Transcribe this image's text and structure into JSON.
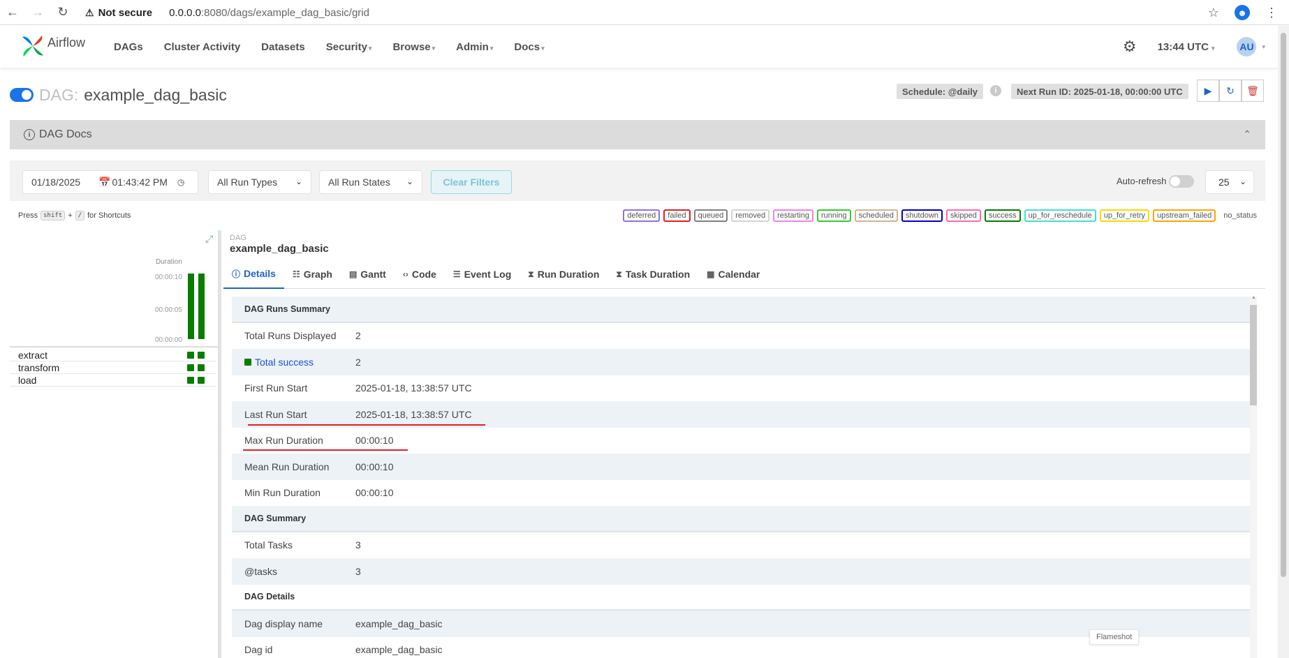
{
  "browser": {
    "security_label": "Not secure",
    "url_host": "0.0.0.0",
    "url_path": ":8080/dags/example_dag_basic/grid"
  },
  "navbar": {
    "brand": "Airflow",
    "menu": [
      "DAGs",
      "Cluster Activity",
      "Datasets",
      "Security",
      "Browse",
      "Admin",
      "Docs"
    ],
    "menu_has_caret": [
      false,
      false,
      false,
      true,
      true,
      true,
      true
    ],
    "time": "13:44 UTC",
    "avatar": "AU"
  },
  "dag": {
    "prefix": "DAG:",
    "name": "example_dag_basic",
    "schedule": "Schedule: @daily",
    "next_run": "Next Run ID: 2025-01-18, 00:00:00 UTC",
    "paused": false
  },
  "docs": {
    "label": "DAG Docs"
  },
  "filters": {
    "date": "01/18/2025",
    "time": "01:43:42 PM",
    "run_types": "All Run Types",
    "run_states": "All Run States",
    "clear": "Clear Filters",
    "auto_refresh": "Auto-refresh",
    "per_page": "25"
  },
  "shortcuts": {
    "press": "Press",
    "key1": "shift",
    "plus": "+",
    "key2": "/",
    "suffix": "for Shortcuts"
  },
  "legend": [
    {
      "label": "deferred",
      "color": "#9370db"
    },
    {
      "label": "failed",
      "color": "#e02020"
    },
    {
      "label": "queued",
      "color": "#808080"
    },
    {
      "label": "removed",
      "color": "#d3d3d3"
    },
    {
      "label": "restarting",
      "color": "#ee82ee"
    },
    {
      "label": "running",
      "color": "#32cd32"
    },
    {
      "label": "scheduled",
      "color": "#d2b48c"
    },
    {
      "label": "shutdown",
      "color": "#0000cc"
    },
    {
      "label": "skipped",
      "color": "#ff69b4"
    },
    {
      "label": "success",
      "color": "#008000"
    },
    {
      "label": "up_for_reschedule",
      "color": "#40e0d0"
    },
    {
      "label": "up_for_retry",
      "color": "#ffd700"
    },
    {
      "label": "upstream_failed",
      "color": "#ffa500"
    },
    {
      "label": "no_status",
      "color": ""
    }
  ],
  "grid": {
    "duration_label": "Duration",
    "ticks": [
      "00:00:10",
      "00:00:05",
      "00:00:00"
    ],
    "runs_duration_sec": [
      10,
      10
    ],
    "max_sec": 10,
    "tasks": [
      "extract",
      "transform",
      "load"
    ]
  },
  "detail": {
    "dag_label": "DAG",
    "dag_title": "example_dag_basic",
    "tabs": [
      "Details",
      "Graph",
      "Gantt",
      "Code",
      "Event Log",
      "Run Duration",
      "Task Duration",
      "Calendar"
    ],
    "active_tab": "Details",
    "rows": [
      {
        "type": "header",
        "key": "DAG Runs Summary"
      },
      {
        "type": "row",
        "key": "Total Runs Displayed",
        "value": "2"
      },
      {
        "type": "row",
        "key": "Total success",
        "value": "2",
        "status": "success"
      },
      {
        "type": "row",
        "key": "First Run Start",
        "value": "2025-01-18, 13:38:57 UTC"
      },
      {
        "type": "row",
        "key": "Last Run Start",
        "value": "2025-01-18, 13:38:57 UTC"
      },
      {
        "type": "row",
        "key": "Max Run Duration",
        "value": "00:00:10"
      },
      {
        "type": "row",
        "key": "Mean Run Duration",
        "value": "00:00:10"
      },
      {
        "type": "row",
        "key": "Min Run Duration",
        "value": "00:00:10"
      },
      {
        "type": "header",
        "key": "DAG Summary"
      },
      {
        "type": "row",
        "key": "Total Tasks",
        "value": "3"
      },
      {
        "type": "row",
        "key": "@tasks",
        "value": "3"
      },
      {
        "type": "header",
        "key": "DAG Details"
      },
      {
        "type": "row",
        "key": "Dag display name",
        "value": "example_dag_basic"
      },
      {
        "type": "row",
        "key": "Dag id",
        "value": "example_dag_basic"
      }
    ]
  },
  "flameshot": "Flameshot"
}
